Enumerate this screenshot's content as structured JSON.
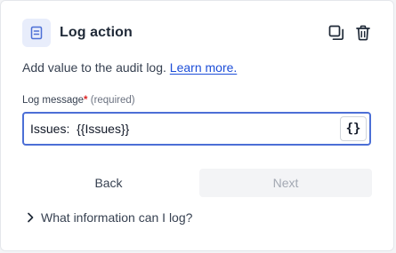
{
  "header": {
    "title": "Log action",
    "icon": "log-list-icon",
    "icon_bg": "#e8edfb",
    "icon_color": "#4c6fd6",
    "actions": [
      {
        "icon": "duplicate-icon"
      },
      {
        "icon": "trash-icon"
      }
    ]
  },
  "description": {
    "text": "Add value to the audit log.",
    "link_label": "Learn more."
  },
  "field": {
    "label": "Log message",
    "required_mark": "*",
    "required_text": "(required)",
    "value": "Issues:  {{Issues}}",
    "variable_button_label": "{}"
  },
  "buttons": {
    "back_label": "Back",
    "next_label": "Next"
  },
  "expander": {
    "label": "What information can I log?",
    "icon": "chevron-right-icon"
  },
  "colors": {
    "accent": "#4c6fd6",
    "link": "#1d4ed8",
    "required": "#dc2626",
    "disabled_bg": "#f3f4f6",
    "disabled_text": "#a3a9b3"
  }
}
